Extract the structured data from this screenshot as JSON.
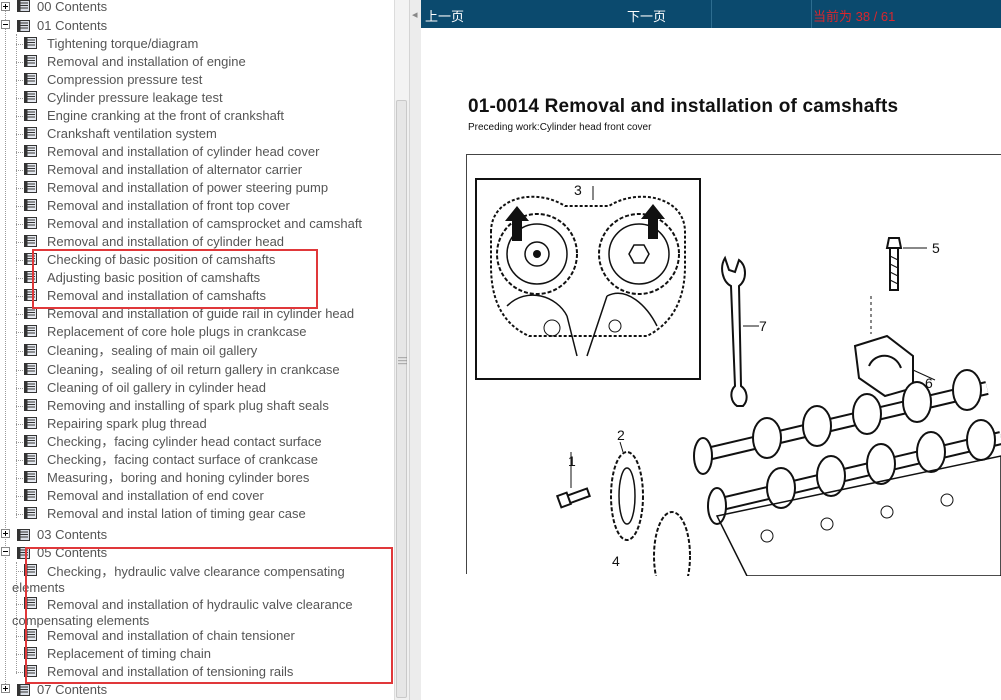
{
  "tree": {
    "chapters": {
      "c00": "00 Contents",
      "c01": "01 Contents",
      "c03": "03 Contents",
      "c05": "05 Contents",
      "c07": "07 Contents"
    },
    "items01": [
      "Tightening torque/diagram",
      "Removal and installation of engine",
      "Compression pressure test",
      "Cylinder pressure leakage test",
      "Engine cranking at the front of crankshaft",
      "Crankshaft ventilation system",
      "Removal and installation of cylinder head cover",
      "Removal and installation of alternator carrier",
      "Removal and installation of power steering pump",
      "Removal and installation of front top cover",
      "Removal and installation of camsprocket and camshaft",
      "Removal and installation of cylinder head",
      "Checking of basic position of camshafts",
      "Adjusting basic position of camshafts",
      "Removal and installation of camshafts",
      "Removal and installation of guide rail in cylinder head",
      "Replacement of core hole plugs in crankcase",
      "Cleaning，sealing of main oil gallery",
      "Cleaning，sealing of oil return gallery in crankcase",
      "Cleaning of oil gallery in cylinder head",
      "Removing and installing of spark plug shaft seals",
      "Repairing spark plug thread",
      "Checking，facing cylinder head contact surface",
      "Checking，facing contact surface of crankcase",
      "Measuring，boring and honing cylinder bores",
      "Removal and installation of end cover",
      "Removal and instal lation of timing gear case"
    ],
    "items05": [
      {
        "l1": "Checking，hydraulic valve clearance compensating",
        "l2": "elements"
      },
      {
        "l1": "Removal and installation of hydraulic valve clearance",
        "l2": "compensating elements"
      },
      {
        "l1": "Removal and installation of chain tensioner"
      },
      {
        "l1": "Replacement of timing chain"
      },
      {
        "l1": "Removal and installation of tensioning rails"
      }
    ]
  },
  "toolbar": {
    "prev": "上一页",
    "next": "下一页",
    "status": "当前为 38 / 61"
  },
  "doc": {
    "title": "01-0014 Removal and installation of camshafts",
    "subtitle": "Preceding work:Cylinder head front cover",
    "callouts": [
      "1",
      "2",
      "3",
      "4",
      "5",
      "6",
      "7"
    ]
  },
  "colors": {
    "toolbar_bg": "#0b4a6e",
    "status_red": "#d9262c",
    "highlight_box": "#e0383a",
    "tree_text": "#555555"
  }
}
